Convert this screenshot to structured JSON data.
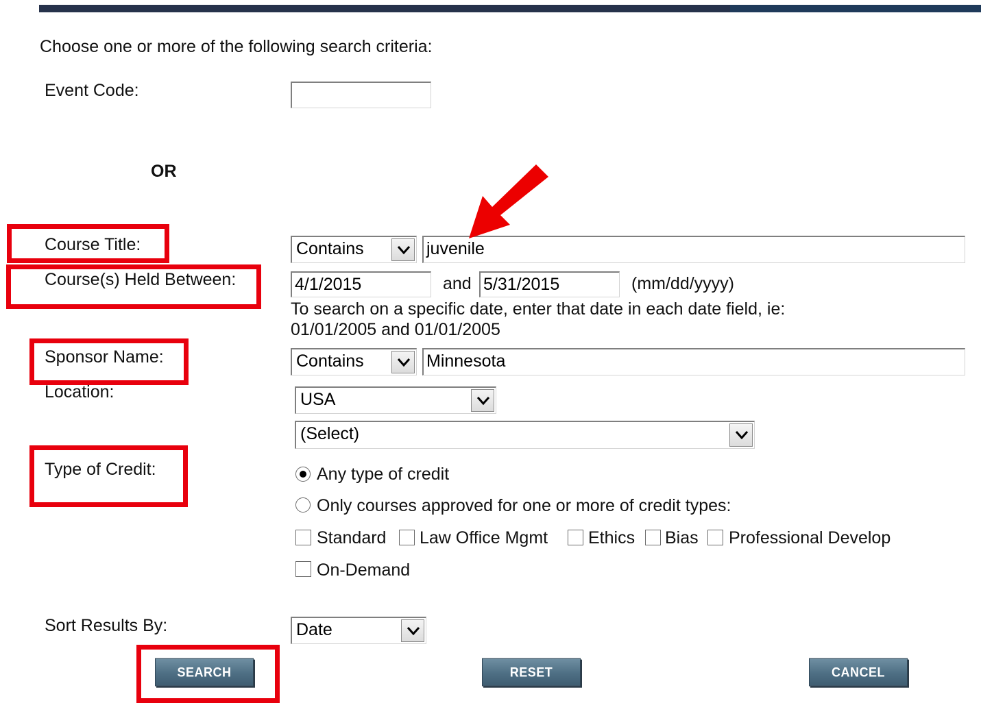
{
  "intro": "Choose one or more of the following search criteria:",
  "event_code": {
    "label": "Event Code:",
    "value": ""
  },
  "or_label": "OR",
  "course_title": {
    "label": "Course Title:",
    "operator": "Contains",
    "value": "juvenile"
  },
  "dates": {
    "label": "Course(s) Held Between:",
    "start": "4/1/2015",
    "and_label": "and",
    "end": "5/31/2015",
    "format_hint": "(mm/dd/yyyy)",
    "help_line1": "To search on a specific date, enter that date in each date field, ie:",
    "help_line2": "01/01/2005 and 01/01/2005"
  },
  "sponsor": {
    "label": "Sponsor Name:",
    "operator": "Contains",
    "value": "Minnesota"
  },
  "location": {
    "label": "Location:",
    "country": "USA",
    "region": "(Select)"
  },
  "credit": {
    "label": "Type of Credit:",
    "option_any": "Any type of credit",
    "option_only": "Only courses approved for one or more of credit types:",
    "selected": "any",
    "types": [
      "Standard",
      "Law Office Mgmt",
      "Ethics",
      "Bias",
      "Professional Develop",
      "On-Demand"
    ]
  },
  "sort": {
    "label": "Sort Results By:",
    "value": "Date"
  },
  "buttons": {
    "search": "SEARCH",
    "reset": "RESET",
    "cancel": "CANCEL"
  },
  "colors": {
    "highlight": "#e8000d",
    "button": "#4e6f84"
  },
  "icons": {
    "arrow": "red-arrow-icon",
    "dropdown": "chevron-down-icon"
  }
}
